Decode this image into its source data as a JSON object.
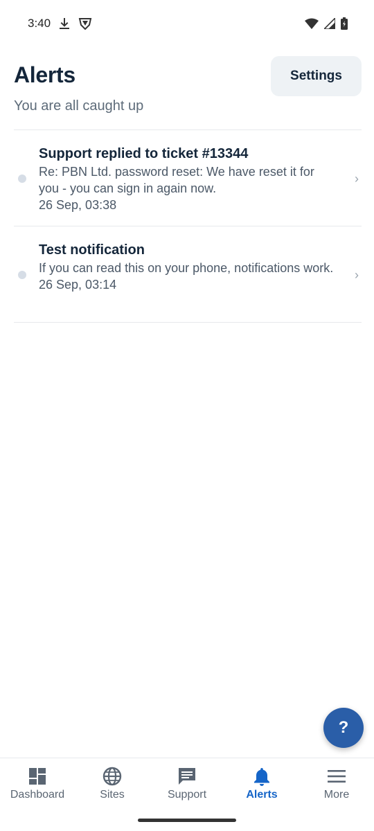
{
  "status_bar": {
    "time": "3:40"
  },
  "header": {
    "title": "Alerts",
    "subtitle": "You are all caught up",
    "settings_label": "Settings"
  },
  "alerts": [
    {
      "title": "Support replied to ticket #13344",
      "body": "Re: PBN Ltd. password reset: We have reset it for you - you can sign in again now.",
      "time": "26 Sep, 03:38"
    },
    {
      "title": "Test notification",
      "body": "If you can read this on your phone, notifications work.",
      "time": "26 Sep, 03:14"
    }
  ],
  "help_fab": {
    "label": "?"
  },
  "bottom_nav": {
    "items": [
      {
        "label": "Dashboard",
        "icon": "dashboard-icon"
      },
      {
        "label": "Sites",
        "icon": "globe-icon"
      },
      {
        "label": "Support",
        "icon": "chat-icon"
      },
      {
        "label": "Alerts",
        "icon": "bell-icon",
        "active": true
      },
      {
        "label": "More",
        "icon": "menu-icon"
      }
    ]
  },
  "colors": {
    "accent": "#1565c8",
    "fab": "#2a5ea8",
    "title": "#14263a",
    "muted": "#5d6b79"
  }
}
